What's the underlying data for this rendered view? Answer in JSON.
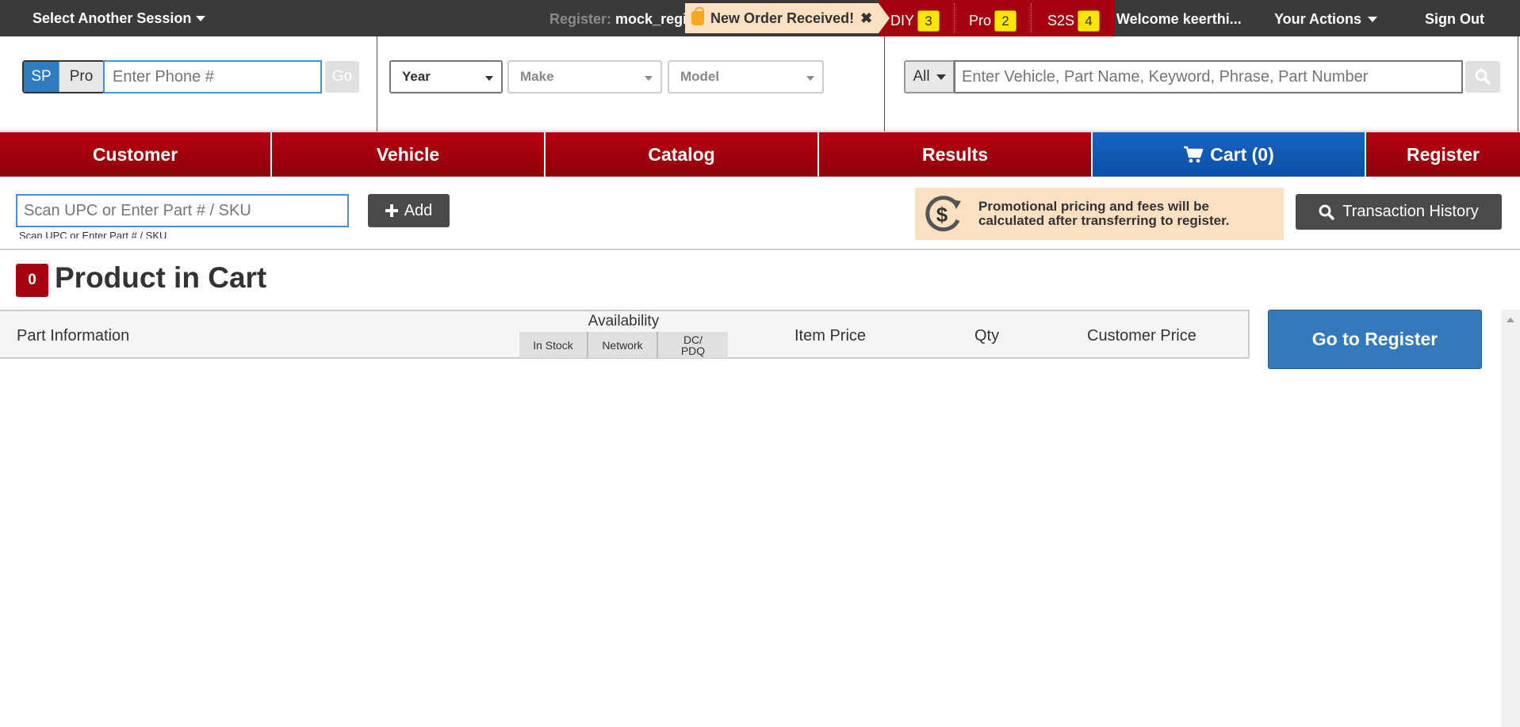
{
  "topbar": {
    "session_label": "Select Another Session",
    "register_label": "Register:",
    "register_value": "mock_regi",
    "notice": "New Order Received!",
    "notice_close": "✖",
    "queues": [
      {
        "label": "DIY",
        "count": "3"
      },
      {
        "label": "Pro",
        "count": "2"
      },
      {
        "label": "S2S",
        "count": "4"
      }
    ],
    "welcome": "Welcome keerthi...",
    "actions": "Your Actions",
    "signout": "Sign Out"
  },
  "search": {
    "customer_toggle": [
      "SP",
      "Pro"
    ],
    "phone_placeholder": "Enter Phone #",
    "go_label": "Go",
    "year": "Year",
    "make": "Make",
    "model": "Model",
    "scope": "All",
    "vehicle_placeholder": "Enter Vehicle, Part Name, Keyword, Phrase, Part Number"
  },
  "nav": {
    "tabs": [
      "Customer",
      "Vehicle",
      "Catalog",
      "Results",
      "Cart (0)",
      "Register"
    ]
  },
  "cart": {
    "scan_placeholder": "Scan UPC or Enter Part # / SKU",
    "scan_hint": "Scan UPC or Enter Part # / SKU",
    "add_label": "Add",
    "promo_text": "Promotional pricing and fees will be calculated after transferring to register.",
    "history_label": "Transaction History",
    "count": "0",
    "title": "Product in Cart",
    "go_to_register": "Go to Register"
  },
  "table": {
    "part_info": "Part Information",
    "availability": "Availability",
    "in_stock": "In Stock",
    "network": "Network",
    "dc": "DC/ PDQ",
    "item_price": "Item Price",
    "qty": "Qty",
    "customer_price": "Customer Price"
  },
  "colors": {
    "brand_red": "#a4000f",
    "cart_blue": "#1565c0",
    "badge_yellow": "#ffe600",
    "notice_bg": "#fbe0c2"
  },
  "icons": [
    "caret-down-icon",
    "shopping-bag-icon",
    "close-icon",
    "search-icon",
    "cart-icon",
    "plus-icon",
    "dollar-refresh-icon"
  ]
}
